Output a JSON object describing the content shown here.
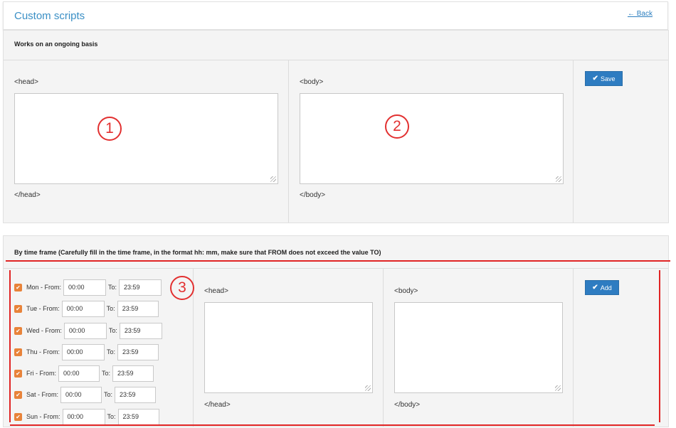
{
  "header": {
    "title": "Custom scripts",
    "back_label": "← Back"
  },
  "ongoing": {
    "title": "Works on an ongoing basis",
    "head_open": "<head>",
    "head_close": "</head>",
    "body_open": "<body>",
    "body_close": "</body>",
    "save_label": "Save",
    "marker1": "1",
    "marker2": "2"
  },
  "timeframe": {
    "title": "By time frame (Carefully fill in the time frame, in the format hh: mm, make sure that FROM does not exceed the value TO)",
    "head_open": "<head>",
    "head_close": "</head>",
    "body_open": "<body>",
    "body_close": "</body>",
    "add_label": "Add",
    "marker3": "3",
    "to_label": "To:",
    "days": [
      {
        "label": "Mon - From:",
        "from": "00:00",
        "to": "23:59",
        "checked": true
      },
      {
        "label": "Tue - From:",
        "from": "00:00",
        "to": "23:59",
        "checked": true
      },
      {
        "label": "Wed - From:",
        "from": "00:00",
        "to": "23:59",
        "checked": true
      },
      {
        "label": "Thu - From:",
        "from": "00:00",
        "to": "23:59",
        "checked": true
      },
      {
        "label": "Fri - From:",
        "from": "00:00",
        "to": "23:59",
        "checked": true
      },
      {
        "label": "Sat - From:",
        "from": "00:00",
        "to": "23:59",
        "checked": true
      },
      {
        "label": "Sun - From:",
        "from": "00:00",
        "to": "23:59",
        "checked": true
      }
    ]
  },
  "colors": {
    "accent": "#2e7cc1",
    "checkbox": "#e8833a",
    "annotation": "#e02424"
  },
  "icons": {
    "save": "check-icon",
    "add": "check-icon"
  }
}
